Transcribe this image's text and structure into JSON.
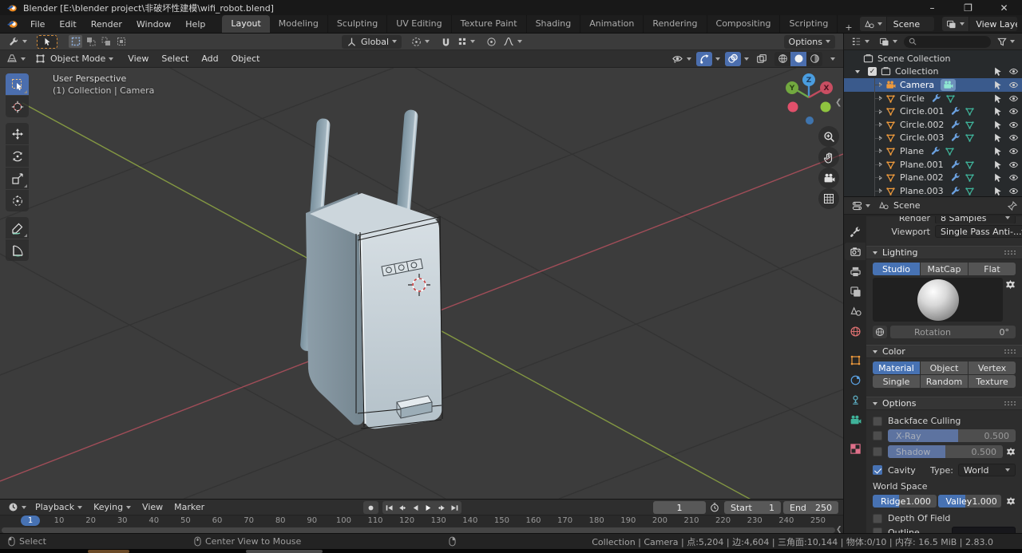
{
  "window": {
    "title": "Blender [E:\\blender project\\非破坏性建模\\wifi_robot.blend]",
    "minimize": "–",
    "maximize": "❐",
    "close": "✕"
  },
  "topbar": {
    "menus": [
      "File",
      "Edit",
      "Render",
      "Window",
      "Help"
    ],
    "workspaces": [
      {
        "label": "Layout",
        "active": true
      },
      {
        "label": "Modeling"
      },
      {
        "label": "Sculpting"
      },
      {
        "label": "UV Editing"
      },
      {
        "label": "Texture Paint"
      },
      {
        "label": "Shading"
      },
      {
        "label": "Animation"
      },
      {
        "label": "Rendering"
      },
      {
        "label": "Compositing"
      },
      {
        "label": "Scripting"
      }
    ],
    "add_workspace": "+",
    "scene_selector": {
      "value": "Scene"
    },
    "view_layer_selector": {
      "value": "View Layer"
    }
  },
  "tool_header": {
    "orientation": "Global",
    "options": "Options"
  },
  "viewport": {
    "header": {
      "mode": "Object Mode",
      "menus": [
        "View",
        "Select",
        "Add",
        "Object"
      ]
    },
    "overlay": {
      "line1": "User Perspective",
      "line2": "(1) Collection | Camera"
    },
    "gizmo": {
      "x": "X",
      "y": "Y",
      "z": "Z"
    }
  },
  "outliner": {
    "root": "Scene Collection",
    "collection": "Collection",
    "items": [
      {
        "name": "Camera",
        "type": "camera",
        "selected": true
      },
      {
        "name": "Circle",
        "type": "mesh"
      },
      {
        "name": "Circle.001",
        "type": "mesh"
      },
      {
        "name": "Circle.002",
        "type": "mesh"
      },
      {
        "name": "Circle.003",
        "type": "mesh"
      },
      {
        "name": "Plane",
        "type": "mesh"
      },
      {
        "name": "Plane.001",
        "type": "mesh"
      },
      {
        "name": "Plane.002",
        "type": "mesh"
      },
      {
        "name": "Plane.003",
        "type": "mesh"
      }
    ]
  },
  "properties": {
    "breadcrumb": "Scene",
    "render_row": {
      "label": "Render",
      "value": "8 Samples"
    },
    "viewport_row": {
      "label": "Viewport",
      "value": "Single Pass Anti-..."
    },
    "lighting": {
      "title": "Lighting",
      "tabs": [
        {
          "label": "Studio",
          "active": true
        },
        {
          "label": "MatCap"
        },
        {
          "label": "Flat"
        }
      ],
      "rotation_label": "Rotation",
      "rotation_value": "0°"
    },
    "color": {
      "title": "Color",
      "buttons": [
        {
          "label": "Material",
          "active": true
        },
        {
          "label": "Object"
        },
        {
          "label": "Vertex"
        },
        {
          "label": "Single"
        },
        {
          "label": "Random"
        },
        {
          "label": "Texture"
        }
      ]
    },
    "options": {
      "title": "Options",
      "backface_culling": "Backface Culling",
      "xray": {
        "label": "X-Ray",
        "value": "0.500"
      },
      "shadow": {
        "label": "Shadow",
        "value": "0.500"
      },
      "cavity": {
        "label": "Cavity",
        "type_label": "Type:",
        "type_value": "World"
      },
      "world_space": "World Space",
      "ridge": {
        "label": "Ridge",
        "value": "1.000"
      },
      "valley": {
        "label": "Valley",
        "value": "1.000"
      },
      "depth_of_field": "Depth Of Field",
      "outline": "Outline"
    }
  },
  "timeline": {
    "menus": [
      "Playback",
      "Keying",
      "View",
      "Marker"
    ],
    "current_frame": "1",
    "start": {
      "label": "Start",
      "value": "1"
    },
    "end": {
      "label": "End",
      "value": "250"
    },
    "ticks": [
      1,
      10,
      20,
      30,
      40,
      50,
      60,
      70,
      80,
      90,
      100,
      110,
      120,
      130,
      140,
      150,
      160,
      170,
      180,
      190,
      200,
      210,
      220,
      230,
      240,
      250
    ]
  },
  "statusbar": {
    "hints": [
      {
        "label": "Select"
      },
      {
        "label": "Center View to Mouse"
      }
    ],
    "stats": "Collection | Camera | 点:5,204 | 边:4,604 | 三角面:10,144 | 物体:0/10 | 内存: 16.5 MiB | 2.83.0"
  }
}
